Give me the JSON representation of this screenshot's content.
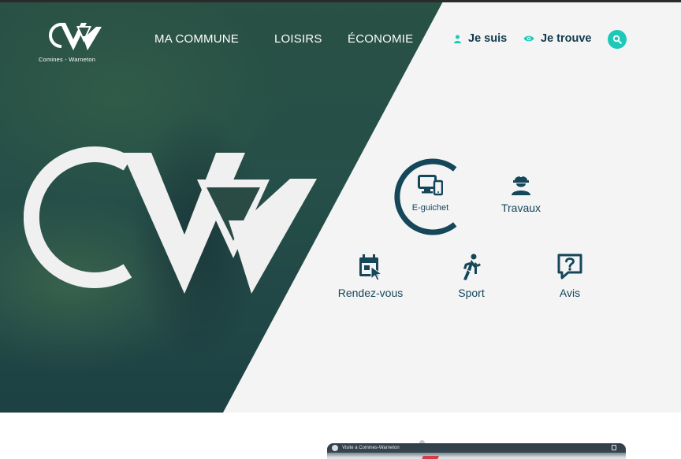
{
  "brand": {
    "name": "Comines - Warneton",
    "accent": "#1cc9b8",
    "primary": "#15465a"
  },
  "nav": {
    "items": [
      {
        "label": "MA COMMUNE"
      },
      {
        "label": "LOISIRS"
      },
      {
        "label": "ÉCONOMIE"
      }
    ]
  },
  "utility": {
    "je_suis": {
      "label": "Je suis",
      "icon": "person-icon"
    },
    "je_trouve": {
      "label": "Je trouve",
      "icon": "eye-icon"
    },
    "search": {
      "icon": "search-icon"
    }
  },
  "quicklinks": [
    {
      "label": "E-guichet",
      "icon": "devices-icon"
    },
    {
      "label": "Travaux",
      "icon": "worker-icon"
    },
    {
      "label": "Rendez-vous",
      "icon": "calendar-icon"
    },
    {
      "label": "Sport",
      "icon": "running-icon"
    },
    {
      "label": "Avis",
      "icon": "question-bubble-icon"
    }
  ],
  "video": {
    "title": "Visite à Comines-Warneton",
    "icon": "copy-icon"
  }
}
